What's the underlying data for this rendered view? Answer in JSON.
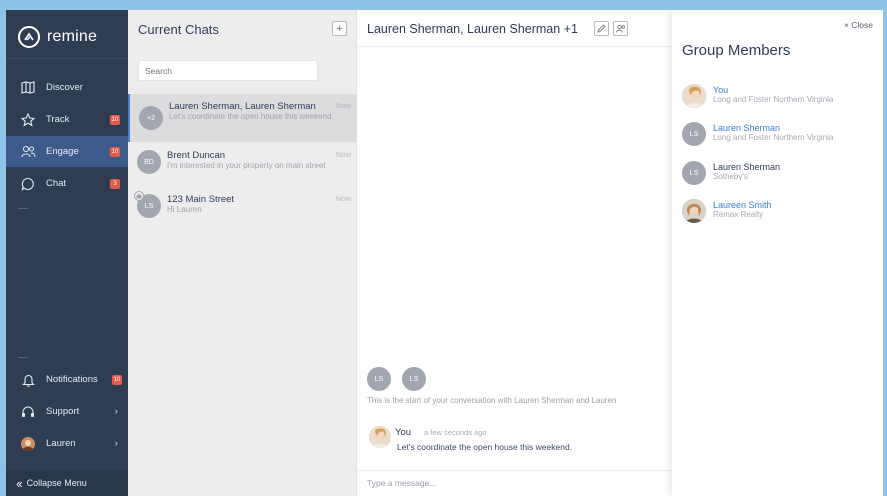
{
  "brand": {
    "name": "remine"
  },
  "sidebar": {
    "items": [
      {
        "label": "Discover",
        "icon": "map-icon"
      },
      {
        "label": "Track",
        "icon": "star-icon",
        "badge": "10"
      },
      {
        "label": "Engage",
        "icon": "people-icon",
        "badge": "10",
        "active": true
      },
      {
        "label": "Chat",
        "icon": "chat-bubble-icon",
        "badge": "3"
      }
    ],
    "bottom_items": [
      {
        "label": "Notifications",
        "icon": "bell-icon",
        "badge": "10"
      },
      {
        "label": "Support",
        "icon": "support-icon"
      },
      {
        "label": "Lauren",
        "icon": "avatar"
      }
    ],
    "collapse_label": "Collapse Menu",
    "colors": {
      "background": "#2f3d53",
      "active": "#3d5a8a",
      "badge": "#e35a4a"
    }
  },
  "chatlist": {
    "title": "Current Chats",
    "add_label": "+",
    "search_placeholder": "Search",
    "chats": [
      {
        "avatar": "+2",
        "name": "Lauren Sherman, Lauren Sherman",
        "message": "Let's coordinate the open house this weekend.",
        "time": "Now",
        "active": true
      },
      {
        "avatar": "BD",
        "name": "Brent Duncan",
        "message": "I'm interested in your property on main street",
        "time": "Now"
      },
      {
        "avatar": "LS",
        "name": "123 Main Street",
        "message": "Hi Lauren",
        "time": "Now"
      }
    ]
  },
  "conversation": {
    "title": "Lauren Sherman, Lauren Sherman +1",
    "participants": [
      "LS",
      "LS"
    ],
    "start_text": "This is the start of your conversation with Lauren Sherman and Lauren",
    "messages": [
      {
        "sender": "You",
        "time": "a few seconds ago",
        "text": "Let's coordinate the open house this weekend."
      }
    ],
    "composer_placeholder": "Type a message..."
  },
  "members": {
    "close_label": "× Close",
    "title": "Group Members",
    "list": [
      {
        "avatar": "photo",
        "name": "You",
        "org": "Long and Foster Northern Virginia",
        "link": true
      },
      {
        "avatar": "LS",
        "name": "Lauren Sherman",
        "org": "Long and Foster Northern Virginia",
        "link": true
      },
      {
        "avatar": "LS",
        "name": "Lauren Sherman",
        "org": "Sotheby's",
        "link": false
      },
      {
        "avatar": "photo",
        "name": "Laureen Smith",
        "org": "Remax Realty",
        "link": true
      }
    ],
    "colors": {
      "link": "#3d7fd6",
      "text": "#2f3d53"
    }
  }
}
